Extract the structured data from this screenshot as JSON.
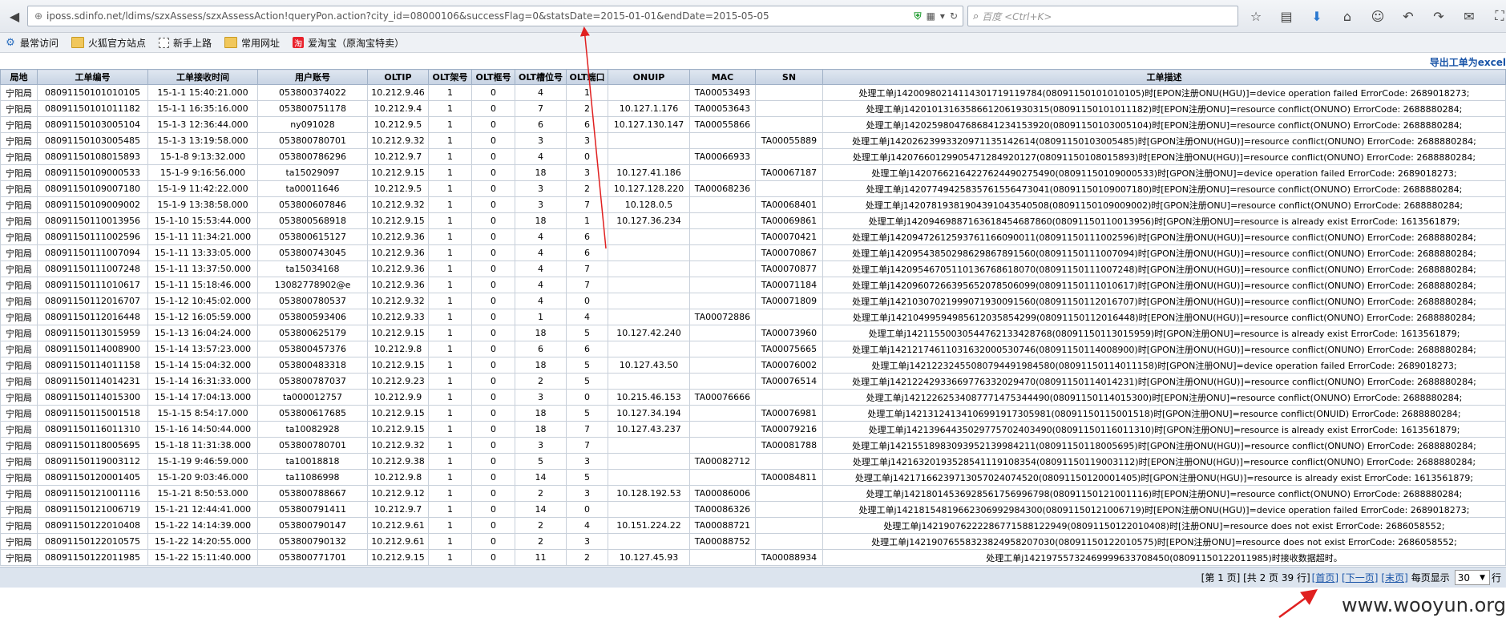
{
  "browser": {
    "url": "iposs.sdinfo.net/ldims/szxAssess/szxAssessAction!queryPon.action?city_id=08000106&successFlag=0&statsDate=2015-01-01&endDate=2015-05-05",
    "search_placeholder": "百度 <Ctrl+K>",
    "nav_icons": [
      "back-arrow-icon"
    ],
    "toolbar_icons": [
      "star-icon",
      "reading-list-icon",
      "download-icon",
      "home-icon",
      "chat-icon",
      "undo-icon",
      "redo-icon",
      "message-icon",
      "screenshot-icon",
      "menu-icon"
    ]
  },
  "bookmarks": [
    {
      "label": "最常访问",
      "icon": "gear-icon"
    },
    {
      "label": "火狐官方站点",
      "icon": "folder-icon"
    },
    {
      "label": "新手上路",
      "icon": "page-icon"
    },
    {
      "label": "常用网址",
      "icon": "folder-icon"
    },
    {
      "label": "爱淘宝（原淘宝特卖）",
      "icon": "taobao-icon"
    }
  ],
  "export_label": "导出工单为excel",
  "columns": [
    "局地",
    "工单编号",
    "工单接收时间",
    "用户账号",
    "OLTIP",
    "OLT架号",
    "OLT框号",
    "OLT槽位号",
    "OLT端口",
    "ONUIP",
    "MAC",
    "SN",
    "工单描述"
  ],
  "rows": [
    [
      "宁阳局",
      "08091150101010105",
      "15-1-1 15:40:21.000",
      "053800374022",
      "10.212.9.46",
      "1",
      "0",
      "4",
      "1",
      "",
      "TA00053493",
      "",
      "处理工单j14200980214114301719119784(08091150101010105)时[EPON注册ONU(HGU)]=device operation failed ErrorCode: 2689018273;"
    ],
    [
      "宁阳局",
      "08091150101011182",
      "15-1-1 16:35:16.000",
      "053800751178",
      "10.212.9.4",
      "1",
      "0",
      "7",
      "2",
      "10.127.1.176",
      "TA00053643",
      "",
      "处理工单j14201013163586612061930315(08091150101011182)时[EPON注册ONU]=resource conflict(ONUNO) ErrorCode: 2688880284;"
    ],
    [
      "宁阳局",
      "08091150103005104",
      "15-1-3 12:36:44.000",
      "ny091028",
      "10.212.9.5",
      "1",
      "0",
      "6",
      "6",
      "10.127.130.147",
      "TA00055866",
      "",
      "处理工单j14202598047686841234153920(08091150103005104)时[EPON注册ONU]=resource conflict(ONUNO) ErrorCode: 2688880284;"
    ],
    [
      "宁阳局",
      "08091150103005485",
      "15-1-3 13:19:58.000",
      "053800780701",
      "10.212.9.32",
      "1",
      "0",
      "3",
      "3",
      "",
      "",
      "TA00055889",
      "处理工单j14202623993320971135142614(08091150103005485)时[GPON注册ONU(HGU)]=resource conflict(ONUNO) ErrorCode: 2688880284;"
    ],
    [
      "宁阳局",
      "08091150108015893",
      "15-1-8 9:13:32.000",
      "053800786296",
      "10.212.9.7",
      "1",
      "0",
      "4",
      "0",
      "",
      "TA00066933",
      "",
      "处理工单j14207660129905471284920127(08091150108015893)时[EPON注册ONU(HGU)]=resource conflict(ONUNO) ErrorCode: 2688880284;"
    ],
    [
      "宁阳局",
      "08091150109000533",
      "15-1-9 9:16:56.000",
      "ta15029097",
      "10.212.9.15",
      "1",
      "0",
      "18",
      "3",
      "10.127.41.186",
      "",
      "TA00067187",
      "处理工单j14207662164227624490275490(08091150109000533)时[GPON注册ONU]=device operation failed ErrorCode: 2689018273;"
    ],
    [
      "宁阳局",
      "08091150109007180",
      "15-1-9 11:42:22.000",
      "ta00011646",
      "10.212.9.5",
      "1",
      "0",
      "3",
      "2",
      "10.127.128.220",
      "TA00068236",
      "",
      "处理工单j14207749425835761556473041(08091150109007180)时[EPON注册ONU]=resource conflict(ONUNO) ErrorCode: 2688880284;"
    ],
    [
      "宁阳局",
      "08091150109009002",
      "15-1-9 13:38:58.000",
      "053800607846",
      "10.212.9.32",
      "1",
      "0",
      "3",
      "7",
      "10.128.0.5",
      "",
      "TA00068401",
      "处理工单j14207819381904391043540508(08091150109009002)时[GPON注册ONU]=resource conflict(ONUNO) ErrorCode: 2688880284;"
    ],
    [
      "宁阳局",
      "08091150110013956",
      "15-1-10 15:53:44.000",
      "053800568918",
      "10.212.9.15",
      "1",
      "0",
      "18",
      "1",
      "10.127.36.234",
      "",
      "TA00069861",
      "处理工单j14209469887163618454687860(08091150110013956)时[GPON注册ONU]=resource is already exist ErrorCode: 1613561879;"
    ],
    [
      "宁阳局",
      "08091150111002596",
      "15-1-11 11:34:21.000",
      "053800615127",
      "10.212.9.36",
      "1",
      "0",
      "4",
      "6",
      "",
      "",
      "TA00070421",
      "处理工单j14209472612593761166090011(08091150111002596)时[GPON注册ONU(HGU)]=resource conflict(ONUNO) ErrorCode: 2688880284;"
    ],
    [
      "宁阳局",
      "08091150111007094",
      "15-1-11 13:33:05.000",
      "053800743045",
      "10.212.9.36",
      "1",
      "0",
      "4",
      "6",
      "",
      "",
      "TA00070867",
      "处理工单j14209543850298629867891560(08091150111007094)时[GPON注册ONU(HGU)]=resource conflict(ONUNO) ErrorCode: 2688880284;"
    ],
    [
      "宁阳局",
      "08091150111007248",
      "15-1-11 13:37:50.000",
      "ta15034168",
      "10.212.9.36",
      "1",
      "0",
      "4",
      "7",
      "",
      "",
      "TA00070877",
      "处理工单j14209546705110136768618070(08091150111007248)时[GPON注册ONU(HGU)]=resource conflict(ONUNO) ErrorCode: 2688880284;"
    ],
    [
      "宁阳局",
      "08091150111010617",
      "15-1-11 15:18:46.000",
      "13082778902@e",
      "10.212.9.36",
      "1",
      "0",
      "4",
      "7",
      "",
      "",
      "TA00071184",
      "处理工单j14209607266395652078506099(08091150111010617)时[GPON注册ONU(HGU)]=resource conflict(ONUNO) ErrorCode: 2688880284;"
    ],
    [
      "宁阳局",
      "08091150112016707",
      "15-1-12 10:45:02.000",
      "053800780537",
      "10.212.9.32",
      "1",
      "0",
      "4",
      "0",
      "",
      "",
      "TA00071809",
      "处理工单j14210307021999071930091560(08091150112016707)时[GPON注册ONU(HGU)]=resource conflict(ONUNO) ErrorCode: 2688880284;"
    ],
    [
      "宁阳局",
      "08091150112016448",
      "15-1-12 16:05:59.000",
      "053800593406",
      "10.212.9.33",
      "1",
      "0",
      "1",
      "4",
      "",
      "TA00072886",
      "",
      "处理工单j14210499594985612035854299(08091150112016448)时[EPON注册ONU(HGU)]=resource conflict(ONUNO) ErrorCode: 2688880284;"
    ],
    [
      "宁阳局",
      "08091150113015959",
      "15-1-13 16:04:24.000",
      "053800625179",
      "10.212.9.15",
      "1",
      "0",
      "18",
      "5",
      "10.127.42.240",
      "",
      "TA00073960",
      "处理工单j14211550030544762133428768(08091150113015959)时[GPON注册ONU]=resource is already exist ErrorCode: 1613561879;"
    ],
    [
      "宁阳局",
      "08091150114008900",
      "15-1-14 13:57:23.000",
      "053800457376",
      "10.212.9.8",
      "1",
      "0",
      "6",
      "6",
      "",
      "",
      "TA00075665",
      "处理工单j14212174611031632000530746(08091150114008900)时[GPON注册ONU(HGU)]=resource conflict(ONUNO) ErrorCode: 2688880284;"
    ],
    [
      "宁阳局",
      "08091150114011158",
      "15-1-14 15:04:32.000",
      "053800483318",
      "10.212.9.15",
      "1",
      "0",
      "18",
      "5",
      "10.127.43.50",
      "",
      "TA00076002",
      "处理工单j14212232455080794491984580(08091150114011158)时[GPON注册ONU]=device operation failed ErrorCode: 2689018273;"
    ],
    [
      "宁阳局",
      "08091150114014231",
      "15-1-14 16:31:33.000",
      "053800787037",
      "10.212.9.23",
      "1",
      "0",
      "2",
      "5",
      "",
      "",
      "TA00076514",
      "处理工单j14212242933669776332029470(08091150114014231)时[GPON注册ONU(HGU)]=resource conflict(ONUNO) ErrorCode: 2688880284;"
    ],
    [
      "宁阳局",
      "08091150114015300",
      "15-1-14 17:04:13.000",
      "ta000012757",
      "10.212.9.9",
      "1",
      "0",
      "3",
      "0",
      "10.215.46.153",
      "TA00076666",
      "",
      "处理工单j14212262534087771475344490(08091150114015300)时[EPON注册ONU]=resource conflict(ONUNO) ErrorCode: 2688880284;"
    ],
    [
      "宁阳局",
      "08091150115001518",
      "15-1-15 8:54:17.000",
      "053800617685",
      "10.212.9.15",
      "1",
      "0",
      "18",
      "5",
      "10.127.34.194",
      "",
      "TA00076981",
      "处理工单j14213124134106991917305981(08091150115001518)时[GPON注册ONU]=resource conflict(ONUID) ErrorCode: 2688880284;"
    ],
    [
      "宁阳局",
      "08091150116011310",
      "15-1-16 14:50:44.000",
      "ta10082928",
      "10.212.9.15",
      "1",
      "0",
      "18",
      "7",
      "10.127.43.237",
      "",
      "TA00079216",
      "处理工单j14213964435029775702403490(08091150116011310)时[GPON注册ONU]=resource is already exist ErrorCode: 1613561879;"
    ],
    [
      "宁阳局",
      "08091150118005695",
      "15-1-18 11:31:38.000",
      "053800780701",
      "10.212.9.32",
      "1",
      "0",
      "3",
      "7",
      "",
      "",
      "TA00081788",
      "处理工单j14215518983093952139984211(08091150118005695)时[GPON注册ONU(HGU)]=resource conflict(ONUNO) ErrorCode: 2688880284;"
    ],
    [
      "宁阳局",
      "08091150119003112",
      "15-1-19 9:46:59.000",
      "ta10018818",
      "10.212.9.38",
      "1",
      "0",
      "5",
      "3",
      "",
      "TA00082712",
      "",
      "处理工单j14216320193528541119108354(08091150119003112)时[EPON注册ONU(HGU)]=resource conflict(ONUNO) ErrorCode: 2688880284;"
    ],
    [
      "宁阳局",
      "08091150120001405",
      "15-1-20 9:03:46.000",
      "ta11086998",
      "10.212.9.8",
      "1",
      "0",
      "14",
      "5",
      "",
      "",
      "TA00084811",
      "处理工单j14217166239713057024074520(08091150120001405)时[GPON注册ONU(HGU)]=resource is already exist ErrorCode: 1613561879;"
    ],
    [
      "宁阳局",
      "08091150121001116",
      "15-1-21 8:50:53.000",
      "053800788667",
      "10.212.9.12",
      "1",
      "0",
      "2",
      "3",
      "10.128.192.53",
      "TA00086006",
      "",
      "处理工单j14218014536928561756996798(08091150121001116)时[EPON注册ONU]=resource conflict(ONUNO) ErrorCode: 2688880284;"
    ],
    [
      "宁阳局",
      "08091150121006719",
      "15-1-21 12:44:41.000",
      "053800791411",
      "10.212.9.7",
      "1",
      "0",
      "14",
      "0",
      "",
      "TA00086326",
      "",
      "处理工单j14218154819662306992984300(08091150121006719)时[EPON注册ONU(HGU)]=device operation failed ErrorCode: 2689018273;"
    ],
    [
      "宁阳局",
      "08091150122010408",
      "15-1-22 14:14:39.000",
      "053800790147",
      "10.212.9.61",
      "1",
      "0",
      "2",
      "4",
      "10.151.224.22",
      "TA00088721",
      "",
      "处理工单j14219076222286771588122949(08091150122010408)时[注册ONU]=resource does not exist ErrorCode: 2686058552;"
    ],
    [
      "宁阳局",
      "08091150122010575",
      "15-1-22 14:20:55.000",
      "053800790132",
      "10.212.9.61",
      "1",
      "0",
      "2",
      "3",
      "",
      "TA00088752",
      "",
      "处理工单j14219076558323824958207030(08091150122010575)时[EPON注册ONU]=resource does not exist ErrorCode: 2686058552;"
    ],
    [
      "宁阳局",
      "08091150122011985",
      "15-1-22 15:11:40.000",
      "053800771701",
      "10.212.9.15",
      "1",
      "0",
      "11",
      "2",
      "10.127.45.93",
      "",
      "TA00088934",
      "处理工单j14219755732469999633708450(08091150122011985)时接收数据超时。"
    ]
  ],
  "pager": {
    "info": "[第 1 页] [共 2 页 39 行]",
    "first": "[首页]",
    "next": "[下一页]",
    "last": "[末页]",
    "per_page_label": "每页显示",
    "per_page_value": "30",
    "rows_suffix": "行"
  },
  "watermark": "www.wooyun.org",
  "colors": {
    "annotation_arrow": "#e02020",
    "link": "#1a55a8",
    "header_bg": "#c7d3e3"
  }
}
